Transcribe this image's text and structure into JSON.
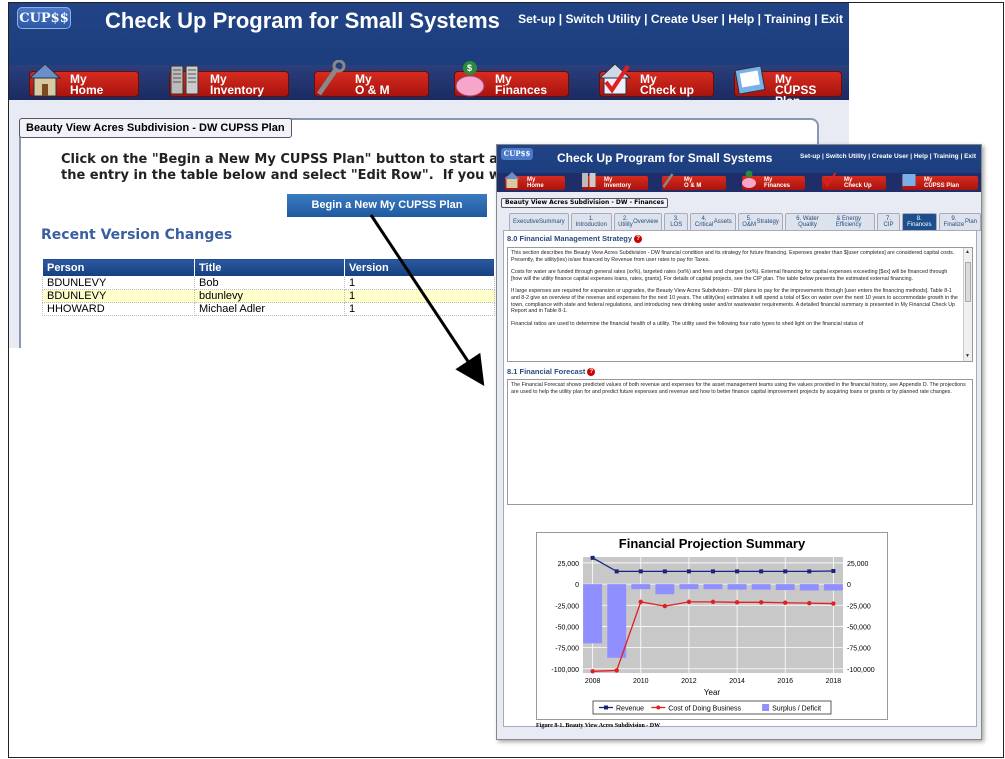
{
  "app": {
    "logo": "CUP$$",
    "title": "Check Up Program for Small Systems",
    "top_links": [
      "Set-up",
      "Switch Utility",
      "Create User",
      "Help",
      "Training",
      "Exit"
    ],
    "nav": [
      {
        "line1": "My",
        "line2": "Home",
        "icon": "house-icon"
      },
      {
        "line1": "My",
        "line2": "Inventory",
        "icon": "server-rack-icon"
      },
      {
        "line1": "My",
        "line2": "O & M",
        "icon": "wrench-icon"
      },
      {
        "line1": "My",
        "line2": "Finances",
        "icon": "piggy-bank-icon"
      },
      {
        "line1": "My",
        "line2": "Check up",
        "icon": "checkmark-house-icon"
      },
      {
        "line1": "My",
        "line2": "CUPSS Plan",
        "icon": "plan-document-icon"
      }
    ]
  },
  "plan": {
    "breadcrumb": "Beauty View Acres Subdivision - DW CUPSS Plan",
    "intro_line1": "Click on the \"Begin a New My CUPSS Plan\" button to start a new plan.  To v",
    "intro_line2": "the entry in the table below and select \"Edit Row\".  If you would like to de",
    "begin_button": "Begin a New My CUPSS Plan",
    "recent_title": "Recent Version Changes",
    "columns": [
      "Person",
      "Title",
      "Version"
    ],
    "rows": [
      [
        "BDUNLEVY",
        "Bob",
        "1"
      ],
      [
        "BDUNLEVY",
        "bdunlevy",
        "1"
      ],
      [
        "HHOWARD",
        "Michael Adler",
        "1"
      ]
    ]
  },
  "finance_view": {
    "logo": "CUP$$",
    "title": "Check Up Program for Small Systems",
    "top_links": "Set-up | Switch Utility | Create User | Help | Training | Exit",
    "nav": [
      {
        "line1": "My",
        "line2": "Home"
      },
      {
        "line1": "My",
        "line2": "Inventory"
      },
      {
        "line1": "My",
        "line2": "O & M"
      },
      {
        "line1": "My",
        "line2": "Finances"
      },
      {
        "line1": "My",
        "line2": "Check Up"
      },
      {
        "line1": "My",
        "line2": "CUPSS Plan"
      }
    ],
    "breadcrumb": "Beauty View Acres Subdivision - DW - Finances",
    "tabs": [
      {
        "line1": "Executive",
        "line2": "Summary"
      },
      {
        "line1": "1. Introduction",
        "line2": ""
      },
      {
        "line1": "2. Utility",
        "line2": "Overview"
      },
      {
        "line1": "3. LOS",
        "line2": ""
      },
      {
        "line1": "4. Critical",
        "line2": "Assets"
      },
      {
        "line1": "5. O&M",
        "line2": "Strategy"
      },
      {
        "line1": "6. Water Quality",
        "line2": "& Energy Efficiency"
      },
      {
        "line1": "7. CIP",
        "line2": ""
      },
      {
        "line1": "8. Finances",
        "line2": ""
      },
      {
        "line1": "9. Finalize",
        "line2": "Plan"
      }
    ],
    "active_tab": 8,
    "section1_title": "8.0 Financial Management Strategy",
    "section1_paragraphs": [
      "This section describes the Beauty View Acres Subdivision - DW financial condition and its strategy for future financing. Expenses greater than $[user completes] are considered capital costs. Presently, the utility(ies) is/are financed by Revenue from user rates to pay for Taxes.",
      "Costs for water are funded through general rates (xx%), targeted rates (xx%) and fees and charges (xx%). External financing for capital expenses exceeding [$xx] will be financed through [how will the utility finance capital expenses loans, rates, grants]. For details of capital projects, see the CIP plan. The table below presents the estimated external financing.",
      "If large expenses are required for expansion or upgrades, the Beauty View Acres Subdivision - DW plans to pay for the improvements through [user enters the financing methods]. Table 8-1 and 8-2 give an overview of the revenue and expenses for the next 10 years. The utility(ies) estimates it will spend a total of $xx on water over the next 10 years to accommodate growth in the town, compliance with state and federal regulations, and introducing new drinking water and/or wastewater requirements. A detailed financial summary is presented in My Financial Check Up Report and in Table 8-1.",
      "Financial ratios are used to determine the financial health of a utility. The utility used the following four ratio types to shed light on the financial status of"
    ],
    "section2_title": "8.1 Financial Forecast",
    "section2_text": "The Financial Forecast shows predicted values of both revenue and expenses for the asset management teams using the values provided in the financial history, see Appendix D. The projections are used to help the utility plan for and predict future expenses and revenue and how to better finance capital improvement projects by acquiring loans or grants or by planned rate changes.",
    "figure_caption": "Figure 8-1. Beauty View Acres Subdivision - DW"
  },
  "chart_data": {
    "type": "bar",
    "title": "Financial Projection Summary",
    "xlabel": "Year",
    "ylabel": "",
    "x": [
      2008,
      2009,
      2010,
      2011,
      2012,
      2013,
      2014,
      2015,
      2016,
      2017,
      2018
    ],
    "xticks": [
      2008,
      2010,
      2012,
      2014,
      2016,
      2018
    ],
    "yticks": [
      25000,
      0,
      -25000,
      -50000,
      -75000,
      -100000
    ],
    "ytick_labels": [
      "25,000",
      "0",
      "-25,000",
      "-50,000",
      "-75,000",
      "-100,000"
    ],
    "ylim": [
      -105000,
      32000
    ],
    "series": [
      {
        "name": "Revenue",
        "kind": "line",
        "color": "#1a237e",
        "values": [
          31000,
          15000,
          15000,
          15000,
          15000,
          15000,
          15000,
          15000,
          15000,
          15000,
          15500
        ]
      },
      {
        "name": "Cost of Doing Business",
        "kind": "line",
        "color": "#e02020",
        "values": [
          -103000,
          -102000,
          -21000,
          -26000,
          -21000,
          -21000,
          -21500,
          -21500,
          -22000,
          -22500,
          -23000
        ]
      },
      {
        "name": "Surplus / Deficit",
        "kind": "bar",
        "color": "#8f8fff",
        "values": [
          -70000,
          -87000,
          -6000,
          -12000,
          -6000,
          -6000,
          -6500,
          -6500,
          -7000,
          -7500,
          -7500
        ]
      }
    ],
    "grid": true,
    "legend": "bottom",
    "background": "#c8c8c8"
  }
}
